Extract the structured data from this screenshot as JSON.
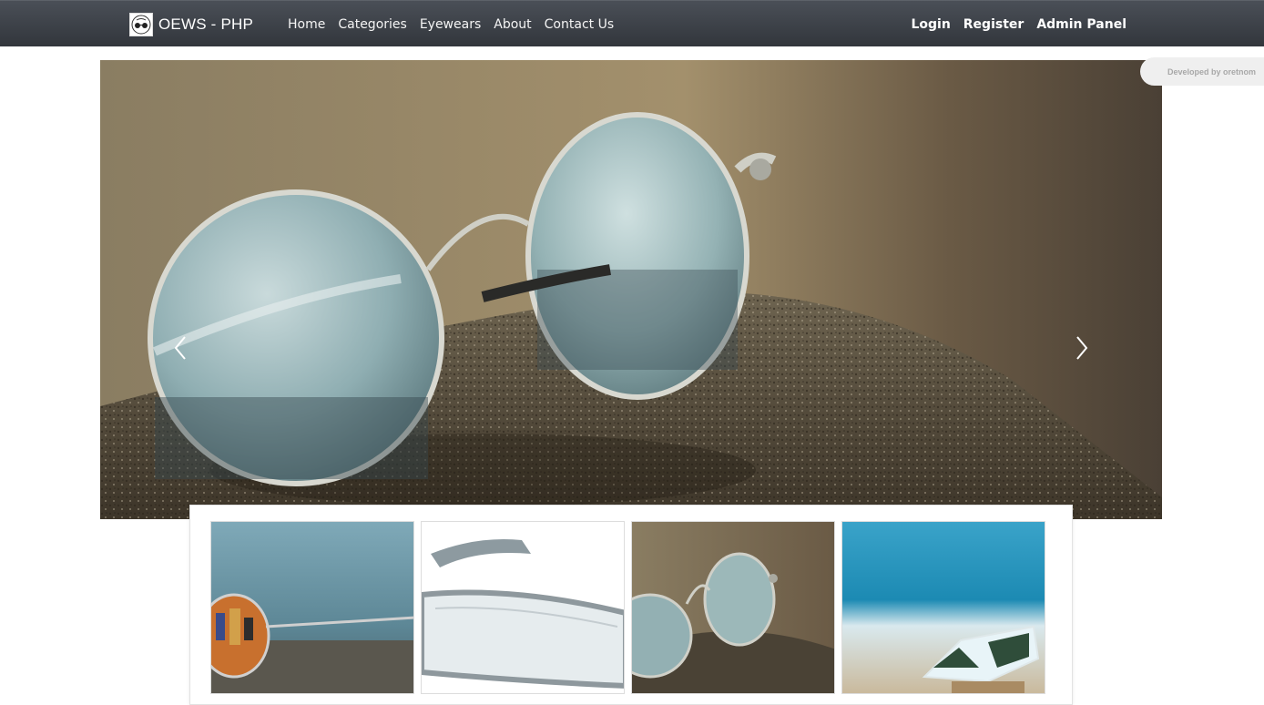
{
  "navbar": {
    "brand_text": "OEWS - PHP",
    "brand_logo_icon": "glasses-logo-icon",
    "links": [
      "Home",
      "Categories",
      "Eyewears",
      "About",
      "Contact Us"
    ],
    "right_links": [
      "Login",
      "Register",
      "Admin Panel"
    ]
  },
  "badge": {
    "text": "Developed by oretnom"
  },
  "carousel": {
    "prev_icon": "chevron-left-icon",
    "next_icon": "chevron-right-icon",
    "image": "round-mirrored-sunglasses-on-rock"
  },
  "thumbnails": [
    {
      "image": "aviator-sunglasses-reflection"
    },
    {
      "image": "clear-safety-goggles"
    },
    {
      "image": "round-sunglasses-on-rock"
    },
    {
      "image": "wayfarer-sunglasses-at-beach"
    }
  ],
  "colors": {
    "navbar_top": "#4a4f57",
    "navbar_bottom": "#32363c",
    "badge_bg": "#efefef",
    "badge_text": "#a8a8a8"
  }
}
